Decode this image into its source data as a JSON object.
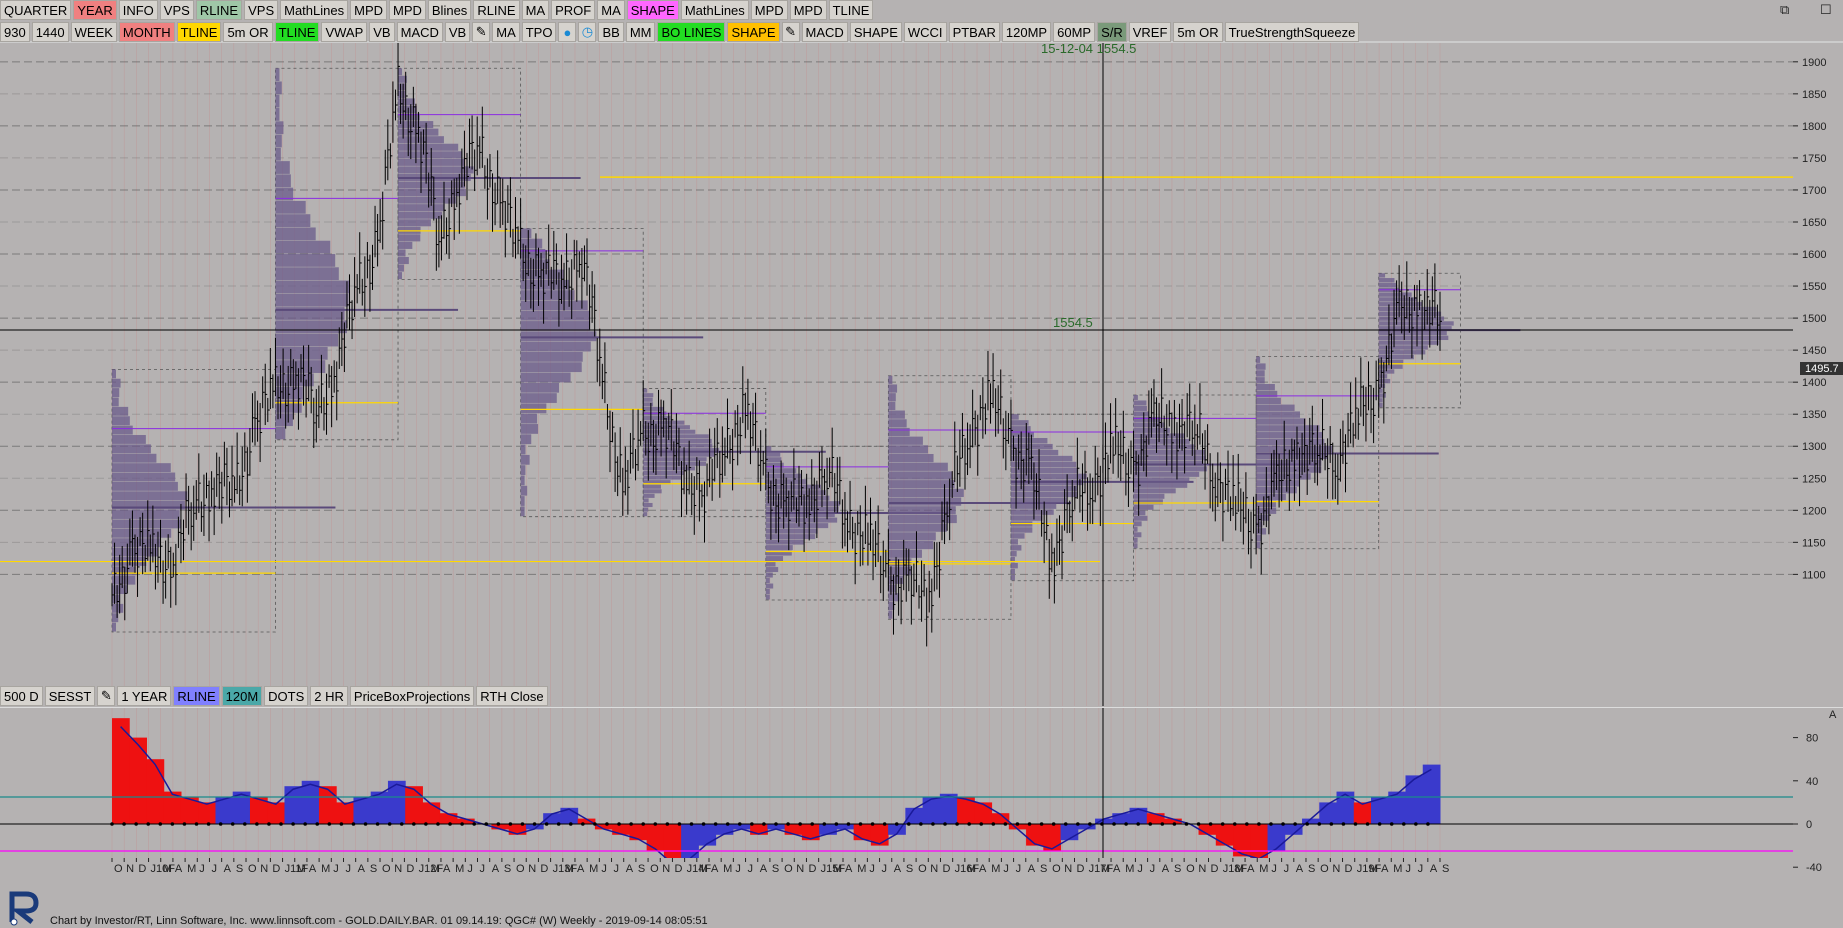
{
  "toolbar1": [
    "QUARTER",
    "YEAR",
    "INFO",
    "VPS",
    "RLINE",
    "VPS",
    "MathLines",
    "MPD",
    "MPD",
    "Blines",
    "RLINE",
    "MA",
    "PROF",
    "MA",
    "SHAPE",
    "MathLines",
    "MPD",
    "MPD",
    "TLINE"
  ],
  "toolbar1_colors": {
    "YEAR": "#f08080",
    "RLINE": "#9fc7a7",
    "SHAPE": "#ff66ff"
  },
  "toolbar2": [
    "930",
    "1440",
    "WEEK",
    "MONTH",
    "TLINE",
    "5m OR",
    "TLINE",
    "VWAP",
    "VB",
    "MACD",
    "VB",
    "pencil-icon",
    "MA",
    "TPO",
    "drop-icon",
    "clock-icon",
    "BB",
    "MM",
    "BO LINES",
    "SHAPE",
    "pencil-icon",
    "MACD",
    "SHAPE",
    "WCCI",
    "PTBAR",
    "120MP",
    "60MP",
    "S/R",
    "VREF",
    "5m OR",
    "TrueStrengthSqueeze"
  ],
  "toolbar2_colors": {
    "MONTH": "#f08080",
    "TLINE": "#ffd700",
    "TLINE2": "#22dd22",
    "BO LINES": "#22dd22",
    "SHAPE": "#ffc000",
    "S/R": "#7a9a7a"
  },
  "toolbar3": [
    "500 D",
    "SESST",
    "pencil-icon",
    "1 YEAR",
    "RLINE",
    "120M",
    "DOTS",
    "2 HR",
    "PriceBoxProjections",
    "RTH Close"
  ],
  "toolbar3_colors": {
    "RLINE": "#8080ff",
    "120M": "#4aa8a8"
  },
  "window_controls": [
    "restore-icon",
    "maximize-icon"
  ],
  "crosshair_label": "15-12-04  1554.5",
  "crosshair_price": "1554.5",
  "last_price": "1495.7",
  "price_axis": [
    "1900",
    "1850",
    "1800",
    "1750",
    "1700",
    "1650",
    "1600",
    "1550",
    "1500",
    "1450",
    "1400",
    "1350",
    "1300",
    "1250",
    "1200",
    "1150",
    "1100"
  ],
  "indicator_axis": [
    "80",
    "40",
    "0",
    "-40"
  ],
  "indicator_marker": "A",
  "time_axis": [
    "O",
    "N",
    "D",
    "J10F",
    "M",
    "A",
    "M",
    "J",
    "J",
    "A",
    "S",
    "O",
    "N",
    "D",
    "J11F",
    "M",
    "A",
    "M",
    "J",
    "J",
    "A",
    "S",
    "O",
    "N",
    "D",
    "J12F",
    "M",
    "A",
    "M",
    "J",
    "J",
    "A",
    "S",
    "O",
    "N",
    "D",
    "J13F",
    "M",
    "A",
    "M",
    "J",
    "J",
    "A",
    "S",
    "O",
    "N",
    "D",
    "J14F",
    "M",
    "A",
    "M",
    "J",
    "J",
    "A",
    "S",
    "O",
    "N",
    "D",
    "J15F",
    "M",
    "A",
    "M",
    "J",
    "J",
    "A",
    "S",
    "O",
    "N",
    "D",
    "J16F",
    "M",
    "A",
    "M",
    "J",
    "J",
    "A",
    "S",
    "O",
    "N",
    "D",
    "J17F",
    "M",
    "A",
    "M",
    "J",
    "J",
    "A",
    "S",
    "O",
    "N",
    "D",
    "J18F",
    "M",
    "A",
    "M",
    "J",
    "J",
    "A",
    "S",
    "O",
    "N",
    "D",
    "J19F",
    "M",
    "A",
    "M",
    "J",
    "J",
    "A",
    "S"
  ],
  "footer": "Chart by Investor/RT, Linn Software, Inc. www.linnsoft.com - GOLD.DAILY.BAR. 01    09.14.19: QGC# (W) Weekly - 2019-09-14 08:05:51",
  "chart_data": {
    "type": "line",
    "title": "",
    "xlabel": "",
    "ylabel": "",
    "ylim": [
      1060,
      1920
    ],
    "x_range": [
      "2009-10",
      "2019-09"
    ],
    "close_approx": [
      1050,
      1150,
      1120,
      1130,
      1200,
      1250,
      1220,
      1340,
      1380,
      1420,
      1350,
      1430,
      1540,
      1620,
      1850,
      1800,
      1620,
      1720,
      1760,
      1680,
      1600,
      1570,
      1560,
      1600,
      1410,
      1230,
      1320,
      1330,
      1260,
      1230,
      1300,
      1350,
      1250,
      1200,
      1220,
      1260,
      1190,
      1150,
      1100,
      1080,
      1070,
      1220,
      1330,
      1370,
      1310,
      1250,
      1130,
      1210,
      1250,
      1290,
      1270,
      1330,
      1340,
      1320,
      1260,
      1200,
      1180,
      1230,
      1300,
      1280,
      1290,
      1340,
      1400,
      1500,
      1530,
      1495
    ],
    "horizontal_levels": [
      {
        "price": 1720,
        "color": "#ffd700"
      },
      {
        "price": 1554.5,
        "color": "#000"
      }
    ],
    "indicator": {
      "name": "TrueStrengthSqueeze",
      "ylim": [
        -50,
        100
      ],
      "reference_levels": [
        {
          "value": 25,
          "color": "#1a8a8a"
        },
        {
          "value": 0,
          "color": "#000"
        },
        {
          "value": -25,
          "color": "#ff00ff"
        }
      ],
      "values": [
        98,
        80,
        60,
        30,
        25,
        20,
        25,
        30,
        25,
        20,
        35,
        40,
        35,
        20,
        25,
        30,
        40,
        35,
        20,
        10,
        5,
        0,
        -5,
        -10,
        -5,
        10,
        15,
        5,
        -5,
        -10,
        -15,
        -25,
        -40,
        -35,
        -20,
        -10,
        -5,
        -10,
        -5,
        -10,
        -15,
        -10,
        -5,
        -15,
        -20,
        -10,
        15,
        25,
        28,
        25,
        20,
        10,
        -5,
        -20,
        -25,
        -15,
        -5,
        5,
        10,
        15,
        10,
        5,
        0,
        -10,
        -20,
        -30,
        -35,
        -25,
        -10,
        5,
        20,
        30,
        20,
        25,
        30,
        45,
        55
      ]
    }
  }
}
